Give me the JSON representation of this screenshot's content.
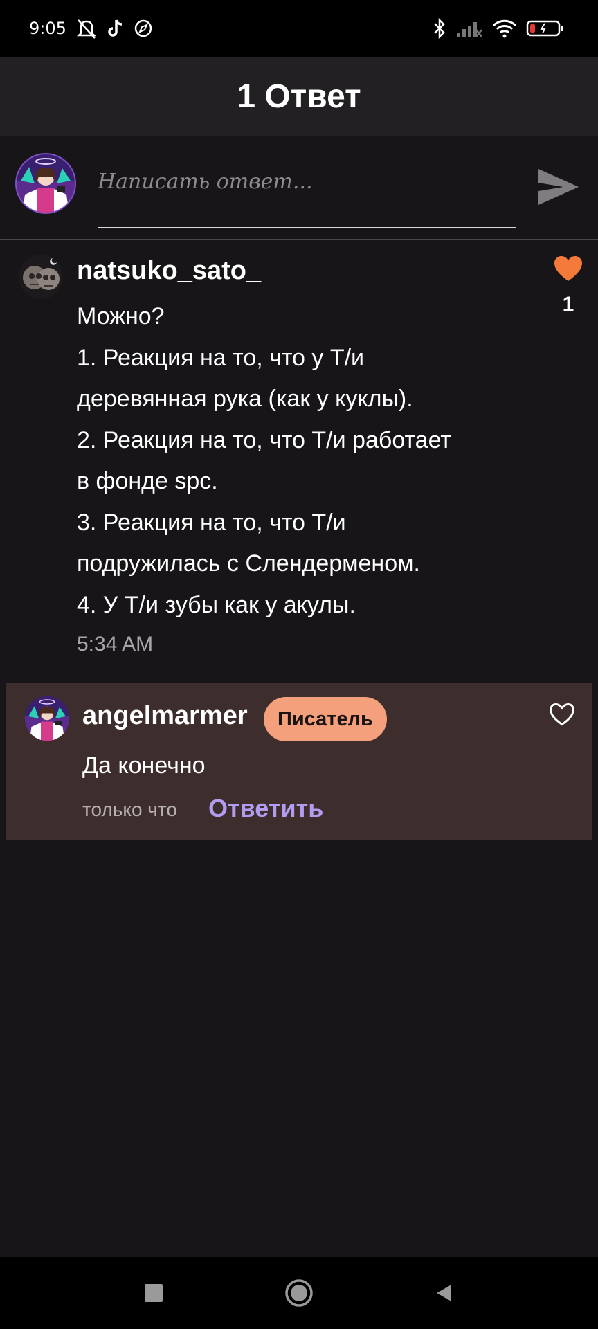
{
  "status_bar": {
    "time": "9:05",
    "left_icons": [
      "mute-bell-icon",
      "tiktok-icon",
      "compass-icon"
    ],
    "right_icons": [
      "bluetooth-icon",
      "signal-icon",
      "wifi-icon",
      "battery-icon"
    ]
  },
  "header": {
    "title": "1 Ответ"
  },
  "composer": {
    "placeholder": "Написать ответ...",
    "send_icon": "send-icon"
  },
  "comment": {
    "author": "natsuko_sato_",
    "lines": [
      "Можно?",
      "1. Реакция на то, что у Т/и",
      "деревянная рука (как у куклы).",
      "2. Реакция на то, что Т/и работает",
      "в фонде spc.",
      "3. Реакция на то, что Т/и",
      "подружилась с Слендерменом.",
      "4. У Т/и зубы как у акулы."
    ],
    "time": "5:34 AM",
    "likes": "1",
    "like_color": "#f47a3a"
  },
  "reply": {
    "author": "angelmarmer",
    "badge": "Писатель",
    "text": "Да конечно",
    "time": "только что",
    "reply_label": "Ответить",
    "accent_color": "#b29cf0",
    "badge_color": "#f4a07c"
  },
  "nav": {
    "buttons": [
      "recents-button",
      "home-button",
      "back-button"
    ]
  }
}
